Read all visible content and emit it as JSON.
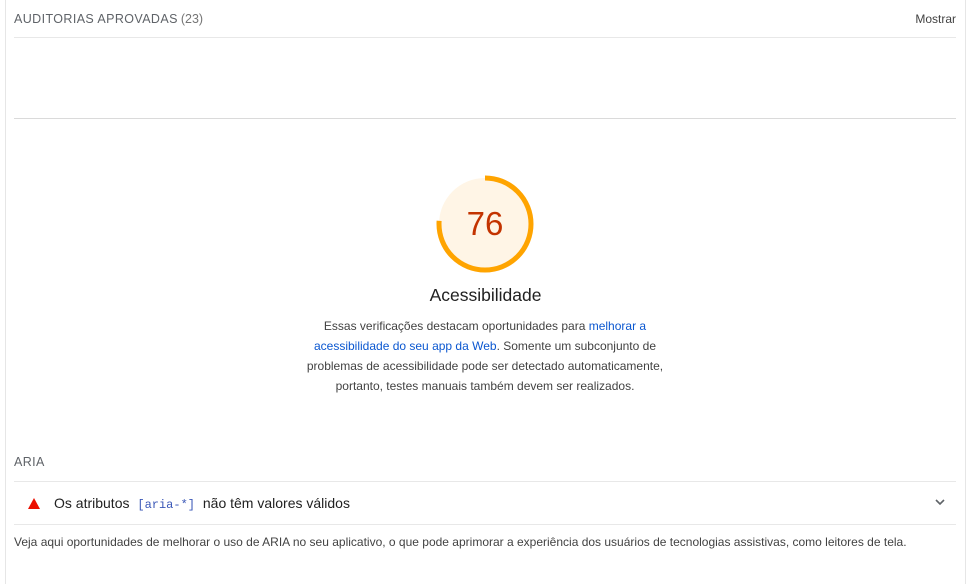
{
  "passed_audits": {
    "title": "AUDITORIAS APROVADAS",
    "count": "(23)",
    "toggle_label": "Mostrar"
  },
  "category": {
    "score": "76",
    "score_fraction": 0.76,
    "score_color": "#c33300",
    "gauge_color": "#ffa400",
    "title": "Acessibilidade",
    "description_before": "Essas verificações destacam oportunidades para ",
    "description_link": "melhorar a acessibilidade do seu app da Web",
    "description_after": ". Somente um subconjunto de problemas de acessibilidade pode ser detectado automaticamente, portanto, testes manuais também devem ser realizados."
  },
  "group": {
    "title": "ARIA",
    "audit": {
      "text_before": "Os atributos",
      "code": "[aria-*]",
      "text_after": "não têm valores válidos",
      "status_icon": "fail-triangle-icon",
      "expand_icon": "chevron-down-icon"
    },
    "description": "Veja aqui oportunidades de melhorar o uso de ARIA no seu aplicativo, o que pode aprimorar a experiência dos usuários de tecnologias assistivas, como leitores de tela."
  }
}
